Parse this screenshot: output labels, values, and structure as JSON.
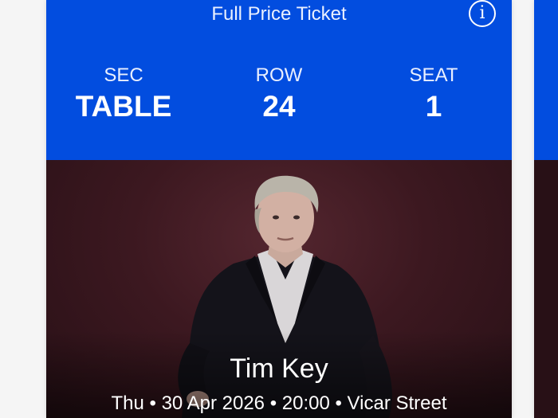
{
  "ticket": {
    "type_label": "Full Price Ticket",
    "info_icon": "info-icon",
    "info_glyph": "i",
    "section": {
      "label": "SEC",
      "value": "TABLE"
    },
    "row": {
      "label": "ROW",
      "value": "24"
    },
    "seat": {
      "label": "SEAT",
      "value": "1"
    }
  },
  "event": {
    "name": "Tim Key",
    "details": "Thu • 30 Apr 2026 • 20:00 • Vicar Street"
  },
  "colors": {
    "header_blue": "#024ddf",
    "photo_background": "#3c1820"
  }
}
